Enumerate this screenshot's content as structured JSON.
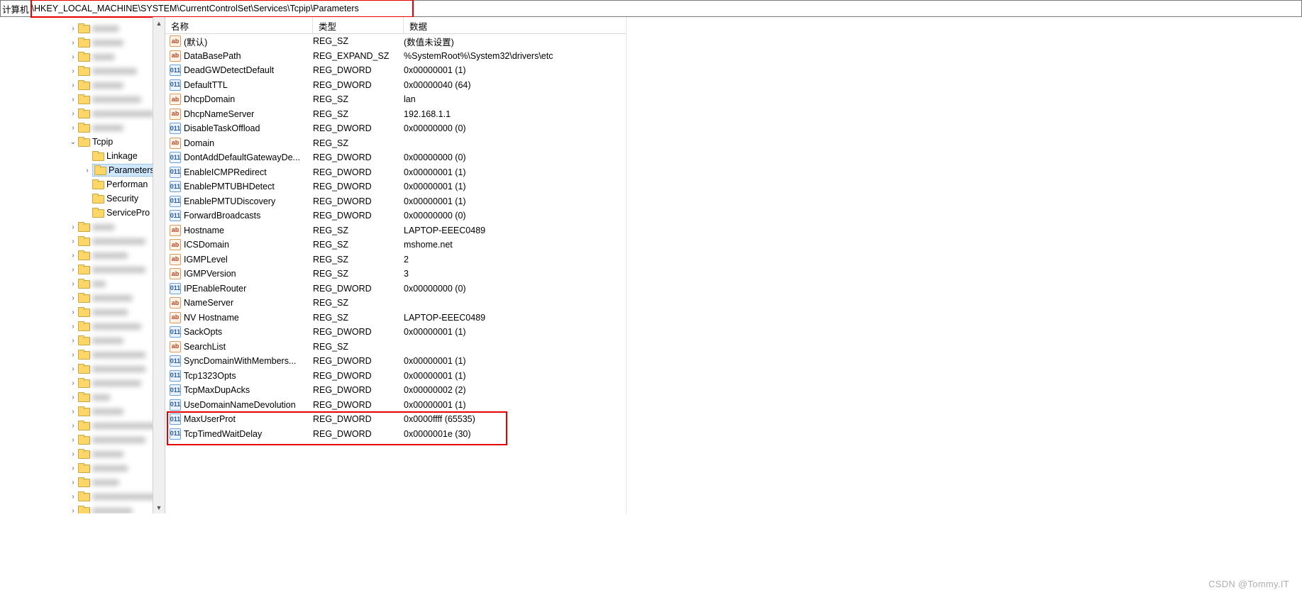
{
  "address": {
    "label": "计算机",
    "path": "\\HKEY_LOCAL_MACHINE\\SYSTEM\\CurrentControlSet\\Services\\Tcpip\\Parameters"
  },
  "tree": {
    "blurred_top": [
      "xxxxxx",
      "xxxxxxx",
      "xxxxx",
      "xxxxxxxxxx",
      "xxxxxxx",
      "xxxxxxxxxxx",
      "xxxxxxxxxxxxxx",
      "xxxxxxx"
    ],
    "tcpip": {
      "label": "Tcpip",
      "children": [
        {
          "label": "Linkage",
          "expandable": false
        },
        {
          "label": "Parameters",
          "expandable": true,
          "selected": true
        },
        {
          "label": "Performan",
          "expandable": false
        },
        {
          "label": "Security",
          "expandable": false
        },
        {
          "label": "ServicePro",
          "expandable": false
        }
      ]
    },
    "blurred_bottom": [
      "xxxxx",
      "xxxxxxxxxxxx",
      "xxxxxxxx",
      "xxxxxxxxxxxx",
      "xxx",
      "xxxxxxxxx",
      "xxxxxxxx",
      "xxxxxxxxxxx",
      "xxxxxxx",
      "xxxxxxxxxxxx",
      "xxxxxxxxxxxx",
      "xxxxxxxxxxx",
      "xxxx",
      "xxxxxxx",
      "xxxxxxxxxxxxxxx",
      "xxxxxxxxxxxx",
      "xxxxxxx",
      "xxxxxxxx",
      "xxxxxx",
      "xxxxxxxxxxxxxxx",
      "xxxxxxxxx",
      "xxxxxxxxxxx"
    ]
  },
  "columns": {
    "name": "名称",
    "type": "类型",
    "data": "数据"
  },
  "values": [
    {
      "icon": "sz",
      "name": "(默认)",
      "type": "REG_SZ",
      "data": "(数值未设置)"
    },
    {
      "icon": "sz",
      "name": "DataBasePath",
      "type": "REG_EXPAND_SZ",
      "data": "%SystemRoot%\\System32\\drivers\\etc"
    },
    {
      "icon": "dw",
      "name": "DeadGWDetectDefault",
      "type": "REG_DWORD",
      "data": "0x00000001 (1)"
    },
    {
      "icon": "dw",
      "name": "DefaultTTL",
      "type": "REG_DWORD",
      "data": "0x00000040 (64)"
    },
    {
      "icon": "sz",
      "name": "DhcpDomain",
      "type": "REG_SZ",
      "data": "lan"
    },
    {
      "icon": "sz",
      "name": "DhcpNameServer",
      "type": "REG_SZ",
      "data": "192.168.1.1"
    },
    {
      "icon": "dw",
      "name": "DisableTaskOffload",
      "type": "REG_DWORD",
      "data": "0x00000000 (0)"
    },
    {
      "icon": "sz",
      "name": "Domain",
      "type": "REG_SZ",
      "data": ""
    },
    {
      "icon": "dw",
      "name": "DontAddDefaultGatewayDe...",
      "type": "REG_DWORD",
      "data": "0x00000000 (0)"
    },
    {
      "icon": "dw",
      "name": "EnableICMPRedirect",
      "type": "REG_DWORD",
      "data": "0x00000001 (1)"
    },
    {
      "icon": "dw",
      "name": "EnablePMTUBHDetect",
      "type": "REG_DWORD",
      "data": "0x00000001 (1)"
    },
    {
      "icon": "dw",
      "name": "EnablePMTUDiscovery",
      "type": "REG_DWORD",
      "data": "0x00000001 (1)"
    },
    {
      "icon": "dw",
      "name": "ForwardBroadcasts",
      "type": "REG_DWORD",
      "data": "0x00000000 (0)"
    },
    {
      "icon": "sz",
      "name": "Hostname",
      "type": "REG_SZ",
      "data": "LAPTOP-EEEC0489"
    },
    {
      "icon": "sz",
      "name": "ICSDomain",
      "type": "REG_SZ",
      "data": "mshome.net"
    },
    {
      "icon": "sz",
      "name": "IGMPLevel",
      "type": "REG_SZ",
      "data": "2"
    },
    {
      "icon": "sz",
      "name": "IGMPVersion",
      "type": "REG_SZ",
      "data": "3"
    },
    {
      "icon": "dw",
      "name": "IPEnableRouter",
      "type": "REG_DWORD",
      "data": "0x00000000 (0)"
    },
    {
      "icon": "sz",
      "name": "NameServer",
      "type": "REG_SZ",
      "data": ""
    },
    {
      "icon": "sz",
      "name": "NV Hostname",
      "type": "REG_SZ",
      "data": "LAPTOP-EEEC0489"
    },
    {
      "icon": "dw",
      "name": "SackOpts",
      "type": "REG_DWORD",
      "data": "0x00000001 (1)"
    },
    {
      "icon": "sz",
      "name": "SearchList",
      "type": "REG_SZ",
      "data": ""
    },
    {
      "icon": "dw",
      "name": "SyncDomainWithMembers...",
      "type": "REG_DWORD",
      "data": "0x00000001 (1)"
    },
    {
      "icon": "dw",
      "name": "Tcp1323Opts",
      "type": "REG_DWORD",
      "data": "0x00000001 (1)"
    },
    {
      "icon": "dw",
      "name": "TcpMaxDupAcks",
      "type": "REG_DWORD",
      "data": "0x00000002 (2)"
    },
    {
      "icon": "dw",
      "name": "UseDomainNameDevolution",
      "type": "REG_DWORD",
      "data": "0x00000001 (1)"
    },
    {
      "icon": "dw",
      "name": "MaxUserProt",
      "type": "REG_DWORD",
      "data": "0x0000ffff (65535)"
    },
    {
      "icon": "dw",
      "name": "TcpTimedWaitDelay",
      "type": "REG_DWORD",
      "data": "0x0000001e (30)"
    }
  ],
  "watermark": "CSDN @Tommy.IT"
}
